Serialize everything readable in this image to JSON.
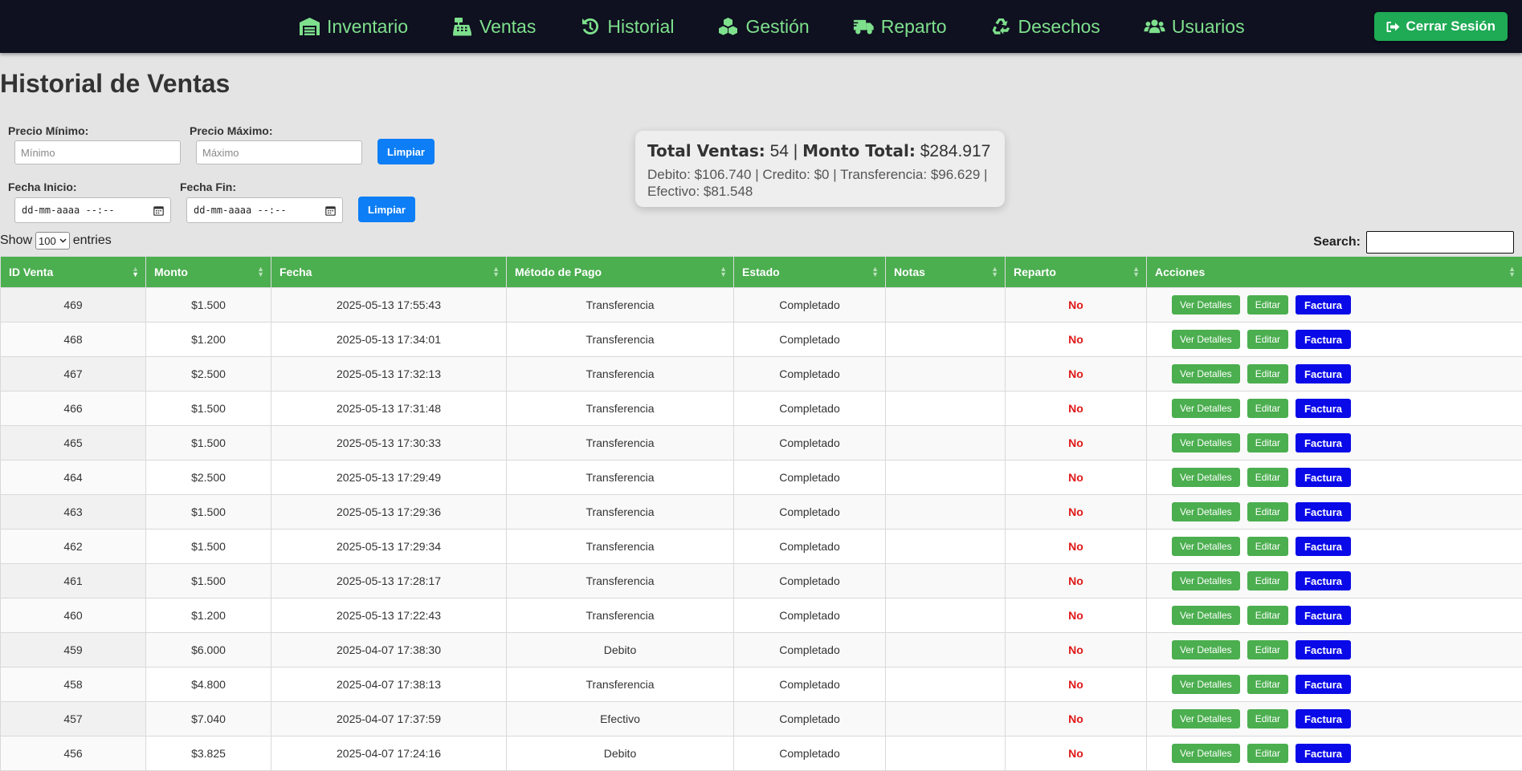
{
  "nav": {
    "items": [
      {
        "label": "Inventario",
        "icon": "warehouse-icon"
      },
      {
        "label": "Ventas",
        "icon": "cash-register-icon"
      },
      {
        "label": "Historial",
        "icon": "history-icon"
      },
      {
        "label": "Gestión",
        "icon": "cubes-icon"
      },
      {
        "label": "Reparto",
        "icon": "truck-icon"
      },
      {
        "label": "Desechos",
        "icon": "recycle-icon"
      },
      {
        "label": "Usuarios",
        "icon": "users-icon"
      }
    ],
    "logout_label": "Cerrar Sesión",
    "accent_color": "#7ee08c"
  },
  "page": {
    "title": "Historial de Ventas"
  },
  "filters": {
    "min_price_label": "Precio Mínimo:",
    "min_price_placeholder": "Mínimo",
    "max_price_label": "Precio Máximo:",
    "max_price_placeholder": "Máximo",
    "clear_label": "Limpiar",
    "start_date_label": "Fecha Inicio:",
    "end_date_label": "Fecha Fin:",
    "date_placeholder": "dd-mm-aaaa --:--",
    "clear_dates_label": "Limpiar"
  },
  "summary": {
    "total_sales_label": "Total Ventas:",
    "total_sales_value": "54",
    "separator": "|",
    "total_amount_label": "Monto Total:",
    "total_amount_value": "$284.917",
    "breakdown": "Debito: $106.740 | Credito: $0 | Transferencia: $96.629 | Efectivo: $81.548"
  },
  "table_controls": {
    "show_label": "Show",
    "page_size": "100",
    "entries_label": "entries",
    "search_label": "Search:"
  },
  "table": {
    "columns": [
      "ID Venta",
      "Monto",
      "Fecha",
      "Método de Pago",
      "Estado",
      "Notas",
      "Reparto",
      "Acciones"
    ],
    "action_labels": {
      "details": "Ver Detalles",
      "edit": "Editar",
      "invoice": "Factura"
    },
    "rows": [
      {
        "id": "469",
        "monto": "$1.500",
        "fecha": "2025-05-13 17:55:43",
        "metodo": "Transferencia",
        "estado": "Completado",
        "notas": "",
        "reparto": "No"
      },
      {
        "id": "468",
        "monto": "$1.200",
        "fecha": "2025-05-13 17:34:01",
        "metodo": "Transferencia",
        "estado": "Completado",
        "notas": "",
        "reparto": "No"
      },
      {
        "id": "467",
        "monto": "$2.500",
        "fecha": "2025-05-13 17:32:13",
        "metodo": "Transferencia",
        "estado": "Completado",
        "notas": "",
        "reparto": "No"
      },
      {
        "id": "466",
        "monto": "$1.500",
        "fecha": "2025-05-13 17:31:48",
        "metodo": "Transferencia",
        "estado": "Completado",
        "notas": "",
        "reparto": "No"
      },
      {
        "id": "465",
        "monto": "$1.500",
        "fecha": "2025-05-13 17:30:33",
        "metodo": "Transferencia",
        "estado": "Completado",
        "notas": "",
        "reparto": "No"
      },
      {
        "id": "464",
        "monto": "$2.500",
        "fecha": "2025-05-13 17:29:49",
        "metodo": "Transferencia",
        "estado": "Completado",
        "notas": "",
        "reparto": "No"
      },
      {
        "id": "463",
        "monto": "$1.500",
        "fecha": "2025-05-13 17:29:36",
        "metodo": "Transferencia",
        "estado": "Completado",
        "notas": "",
        "reparto": "No"
      },
      {
        "id": "462",
        "monto": "$1.500",
        "fecha": "2025-05-13 17:29:34",
        "metodo": "Transferencia",
        "estado": "Completado",
        "notas": "",
        "reparto": "No"
      },
      {
        "id": "461",
        "monto": "$1.500",
        "fecha": "2025-05-13 17:28:17",
        "metodo": "Transferencia",
        "estado": "Completado",
        "notas": "",
        "reparto": "No"
      },
      {
        "id": "460",
        "monto": "$1.200",
        "fecha": "2025-05-13 17:22:43",
        "metodo": "Transferencia",
        "estado": "Completado",
        "notas": "",
        "reparto": "No"
      },
      {
        "id": "459",
        "monto": "$6.000",
        "fecha": "2025-04-07 17:38:30",
        "metodo": "Debito",
        "estado": "Completado",
        "notas": "",
        "reparto": "No"
      },
      {
        "id": "458",
        "monto": "$4.800",
        "fecha": "2025-04-07 17:38:13",
        "metodo": "Transferencia",
        "estado": "Completado",
        "notas": "",
        "reparto": "No"
      },
      {
        "id": "457",
        "monto": "$7.040",
        "fecha": "2025-04-07 17:37:59",
        "metodo": "Efectivo",
        "estado": "Completado",
        "notas": "",
        "reparto": "No"
      },
      {
        "id": "456",
        "monto": "$3.825",
        "fecha": "2025-04-07 17:24:16",
        "metodo": "Debito",
        "estado": "Completado",
        "notas": "",
        "reparto": "No"
      }
    ]
  }
}
